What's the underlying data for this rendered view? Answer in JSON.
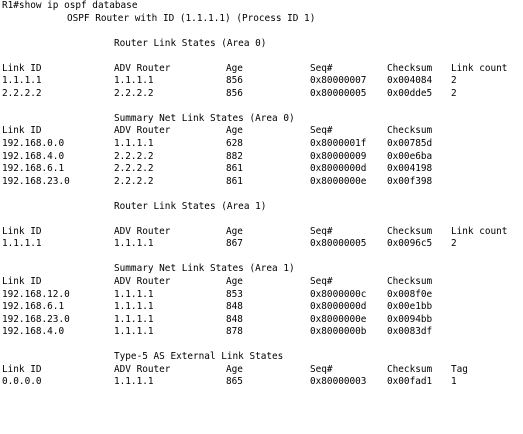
{
  "prompt": "R1#show ip ospf database",
  "title": "OSPF Router with ID (1.1.1.1) (Process ID 1)",
  "sections": [
    {
      "title": "Router Link States (Area 0)",
      "blank_before_header": true,
      "headers": [
        "Link ID",
        "ADV Router",
        "Age",
        "Seq#",
        "Checksum",
        "Link count"
      ],
      "rows": [
        [
          "1.1.1.1",
          "1.1.1.1",
          "856",
          "0x80000007",
          "0x004084",
          "2"
        ],
        [
          "2.2.2.2",
          "2.2.2.2",
          "856",
          "0x80000005",
          "0x00dde5",
          "2"
        ]
      ]
    },
    {
      "title": "Summary Net Link States (Area 0)",
      "blank_before_header": false,
      "headers": [
        "Link ID",
        "ADV Router",
        "Age",
        "Seq#",
        "Checksum"
      ],
      "rows": [
        [
          "192.168.0.0",
          "1.1.1.1",
          "628",
          "0x8000001f",
          "0x00785d"
        ],
        [
          "192.168.4.0",
          "2.2.2.2",
          "882",
          "0x80000009",
          "0x00e6ba"
        ],
        [
          "192.168.6.1",
          "2.2.2.2",
          "861",
          "0x8000000d",
          "0x004198"
        ],
        [
          "192.168.23.0",
          "2.2.2.2",
          "861",
          "0x8000000e",
          "0x00f398"
        ]
      ]
    },
    {
      "title": "Router Link States (Area 1)",
      "blank_before_header": true,
      "headers": [
        "Link ID",
        "ADV Router",
        "Age",
        "Seq#",
        "Checksum",
        "Link count"
      ],
      "rows": [
        [
          "1.1.1.1",
          "1.1.1.1",
          "867",
          "0x80000005",
          "0x0096c5",
          "2"
        ]
      ]
    },
    {
      "title": "Summary Net Link States (Area 1)",
      "blank_before_header": false,
      "headers": [
        "Link ID",
        "ADV Router",
        "Age",
        "Seq#",
        "Checksum"
      ],
      "rows": [
        [
          "192.168.12.0",
          "1.1.1.1",
          "853",
          "0x8000000c",
          "0x008f0e"
        ],
        [
          "192.168.6.1",
          "1.1.1.1",
          "848",
          "0x8000000d",
          "0x00e1bb"
        ],
        [
          "192.168.23.0",
          "1.1.1.1",
          "848",
          "0x8000000e",
          "0x0094bb"
        ],
        [
          "192.168.4.0",
          "1.1.1.1",
          "878",
          "0x8000000b",
          "0x0083df"
        ]
      ]
    },
    {
      "title": "Type-5 AS External Link States",
      "blank_before_header": false,
      "headers": [
        "Link ID",
        "ADV Router",
        "Age",
        "Seq#",
        "Checksum",
        "Tag"
      ],
      "rows": [
        [
          "0.0.0.0",
          "1.1.1.1",
          "865",
          "0x80000003",
          "0x00fad1",
          "1"
        ]
      ]
    }
  ]
}
